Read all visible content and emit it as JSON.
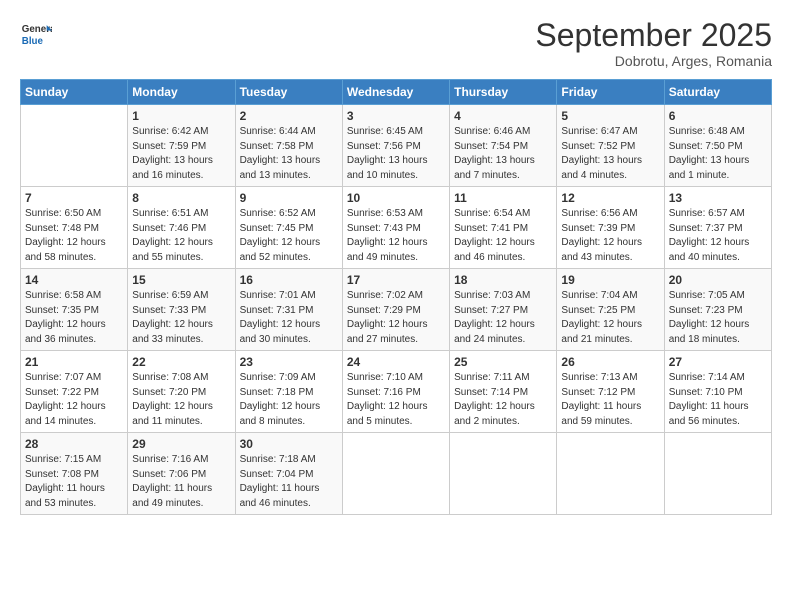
{
  "logo": {
    "line1": "General",
    "line2": "Blue"
  },
  "title": "September 2025",
  "subtitle": "Dobrotu, Arges, Romania",
  "days_header": [
    "Sunday",
    "Monday",
    "Tuesday",
    "Wednesday",
    "Thursday",
    "Friday",
    "Saturday"
  ],
  "weeks": [
    [
      {
        "num": "",
        "info": ""
      },
      {
        "num": "1",
        "info": "Sunrise: 6:42 AM\nSunset: 7:59 PM\nDaylight: 13 hours\nand 16 minutes."
      },
      {
        "num": "2",
        "info": "Sunrise: 6:44 AM\nSunset: 7:58 PM\nDaylight: 13 hours\nand 13 minutes."
      },
      {
        "num": "3",
        "info": "Sunrise: 6:45 AM\nSunset: 7:56 PM\nDaylight: 13 hours\nand 10 minutes."
      },
      {
        "num": "4",
        "info": "Sunrise: 6:46 AM\nSunset: 7:54 PM\nDaylight: 13 hours\nand 7 minutes."
      },
      {
        "num": "5",
        "info": "Sunrise: 6:47 AM\nSunset: 7:52 PM\nDaylight: 13 hours\nand 4 minutes."
      },
      {
        "num": "6",
        "info": "Sunrise: 6:48 AM\nSunset: 7:50 PM\nDaylight: 13 hours\nand 1 minute."
      }
    ],
    [
      {
        "num": "7",
        "info": "Sunrise: 6:50 AM\nSunset: 7:48 PM\nDaylight: 12 hours\nand 58 minutes."
      },
      {
        "num": "8",
        "info": "Sunrise: 6:51 AM\nSunset: 7:46 PM\nDaylight: 12 hours\nand 55 minutes."
      },
      {
        "num": "9",
        "info": "Sunrise: 6:52 AM\nSunset: 7:45 PM\nDaylight: 12 hours\nand 52 minutes."
      },
      {
        "num": "10",
        "info": "Sunrise: 6:53 AM\nSunset: 7:43 PM\nDaylight: 12 hours\nand 49 minutes."
      },
      {
        "num": "11",
        "info": "Sunrise: 6:54 AM\nSunset: 7:41 PM\nDaylight: 12 hours\nand 46 minutes."
      },
      {
        "num": "12",
        "info": "Sunrise: 6:56 AM\nSunset: 7:39 PM\nDaylight: 12 hours\nand 43 minutes."
      },
      {
        "num": "13",
        "info": "Sunrise: 6:57 AM\nSunset: 7:37 PM\nDaylight: 12 hours\nand 40 minutes."
      }
    ],
    [
      {
        "num": "14",
        "info": "Sunrise: 6:58 AM\nSunset: 7:35 PM\nDaylight: 12 hours\nand 36 minutes."
      },
      {
        "num": "15",
        "info": "Sunrise: 6:59 AM\nSunset: 7:33 PM\nDaylight: 12 hours\nand 33 minutes."
      },
      {
        "num": "16",
        "info": "Sunrise: 7:01 AM\nSunset: 7:31 PM\nDaylight: 12 hours\nand 30 minutes."
      },
      {
        "num": "17",
        "info": "Sunrise: 7:02 AM\nSunset: 7:29 PM\nDaylight: 12 hours\nand 27 minutes."
      },
      {
        "num": "18",
        "info": "Sunrise: 7:03 AM\nSunset: 7:27 PM\nDaylight: 12 hours\nand 24 minutes."
      },
      {
        "num": "19",
        "info": "Sunrise: 7:04 AM\nSunset: 7:25 PM\nDaylight: 12 hours\nand 21 minutes."
      },
      {
        "num": "20",
        "info": "Sunrise: 7:05 AM\nSunset: 7:23 PM\nDaylight: 12 hours\nand 18 minutes."
      }
    ],
    [
      {
        "num": "21",
        "info": "Sunrise: 7:07 AM\nSunset: 7:22 PM\nDaylight: 12 hours\nand 14 minutes."
      },
      {
        "num": "22",
        "info": "Sunrise: 7:08 AM\nSunset: 7:20 PM\nDaylight: 12 hours\nand 11 minutes."
      },
      {
        "num": "23",
        "info": "Sunrise: 7:09 AM\nSunset: 7:18 PM\nDaylight: 12 hours\nand 8 minutes."
      },
      {
        "num": "24",
        "info": "Sunrise: 7:10 AM\nSunset: 7:16 PM\nDaylight: 12 hours\nand 5 minutes."
      },
      {
        "num": "25",
        "info": "Sunrise: 7:11 AM\nSunset: 7:14 PM\nDaylight: 12 hours\nand 2 minutes."
      },
      {
        "num": "26",
        "info": "Sunrise: 7:13 AM\nSunset: 7:12 PM\nDaylight: 11 hours\nand 59 minutes."
      },
      {
        "num": "27",
        "info": "Sunrise: 7:14 AM\nSunset: 7:10 PM\nDaylight: 11 hours\nand 56 minutes."
      }
    ],
    [
      {
        "num": "28",
        "info": "Sunrise: 7:15 AM\nSunset: 7:08 PM\nDaylight: 11 hours\nand 53 minutes."
      },
      {
        "num": "29",
        "info": "Sunrise: 7:16 AM\nSunset: 7:06 PM\nDaylight: 11 hours\nand 49 minutes."
      },
      {
        "num": "30",
        "info": "Sunrise: 7:18 AM\nSunset: 7:04 PM\nDaylight: 11 hours\nand 46 minutes."
      },
      {
        "num": "",
        "info": ""
      },
      {
        "num": "",
        "info": ""
      },
      {
        "num": "",
        "info": ""
      },
      {
        "num": "",
        "info": ""
      }
    ]
  ]
}
